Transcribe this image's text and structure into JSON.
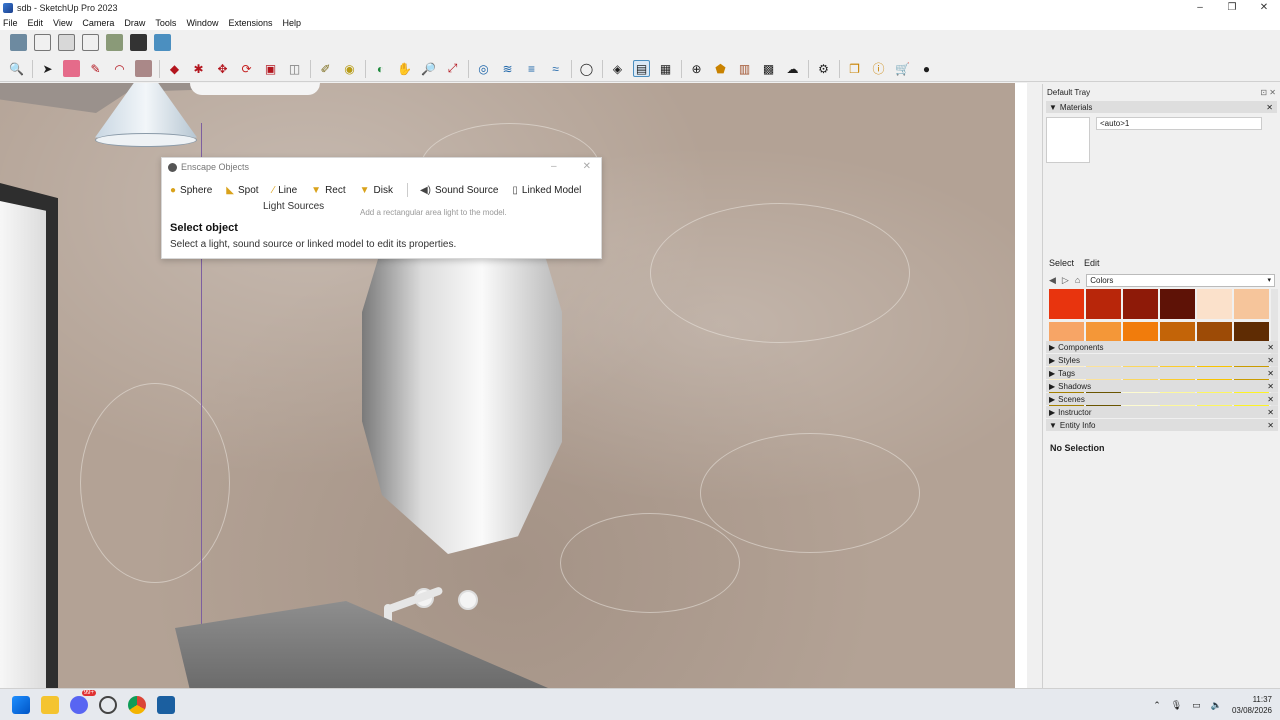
{
  "window": {
    "title": "sdb - SketchUp Pro 2023",
    "controls": [
      "–",
      "❐",
      "✕"
    ]
  },
  "menu": [
    "File",
    "Edit",
    "View",
    "Camera",
    "Draw",
    "Tools",
    "Window",
    "Extensions",
    "Help"
  ],
  "enscape": {
    "title": "Enscape Objects",
    "tools": [
      {
        "label": "Sphere",
        "icon": "sphere-icon"
      },
      {
        "label": "Spot",
        "icon": "spot-icon"
      },
      {
        "label": "Line",
        "icon": "line-icon"
      },
      {
        "label": "Rect",
        "icon": "rect-icon"
      },
      {
        "label": "Disk",
        "icon": "disk-icon"
      },
      {
        "label": "Sound Source",
        "icon": "speaker-icon"
      },
      {
        "label": "Linked Model",
        "icon": "document-icon"
      }
    ],
    "section_label": "Light Sources",
    "tooltip": "Add a rectangular area light to the model.",
    "select_title": "Select object",
    "select_desc": "Select a light, sound source or linked model to edit its properties."
  },
  "tray": {
    "title": "Default Tray",
    "materials_label": "Materials",
    "material_name": "<auto>1",
    "tab_select": "Select",
    "tab_edit": "Edit",
    "collection": "Colors",
    "swatch_colors": [
      "#e8340e",
      "#b8260a",
      "#8e1a08",
      "#5e1206",
      "#fbe1cb",
      "#f6c59b",
      "#f7a566",
      "#f49738",
      "#f17c0c",
      "#c36408",
      "#9d4b06",
      "#5f2c03",
      "#fcefc8",
      "#fbe29a",
      "#fbd75f",
      "#fbcc2e",
      "#f8c300",
      "#c99b00",
      "#a48000",
      "#6a5500",
      "#fdfbd0",
      "#fdf89b",
      "#fdf660",
      "#fdf325"
    ],
    "panels": [
      "Components",
      "Styles",
      "Tags",
      "Shadows",
      "Scenes",
      "Instructor",
      "Entity Info"
    ],
    "entity_status": "No Selection"
  },
  "taskbar": {
    "time": "11:37",
    "date": "03/08/2026",
    "badge": "99+"
  }
}
